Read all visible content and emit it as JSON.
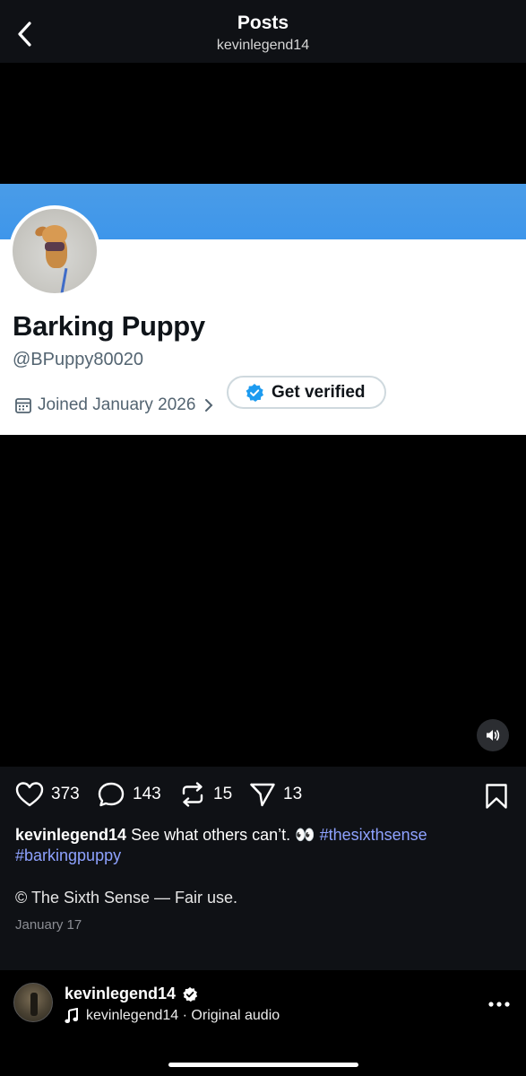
{
  "header": {
    "title": "Posts",
    "subtitle": "kevinlegend14",
    "back_icon": "chevron-left-icon"
  },
  "media": {
    "profile_card": {
      "banner_color": "#4a9ce8",
      "name": "Barking Puppy",
      "verify_label": "Get verified",
      "handle": "@BPuppy80020",
      "joined": "Joined January 2026"
    },
    "sound_icon": "speaker-icon"
  },
  "actions": {
    "likes": "373",
    "comments": "143",
    "reposts": "15",
    "shares": "13"
  },
  "caption": {
    "user": "kevinlegend14",
    "text": "See what others can’t. 👀",
    "tag1": "#thesixthsense",
    "tag2": "#barkingpuppy",
    "copyright": "© The Sixth Sense — Fair use.",
    "date": "January 17"
  },
  "audio": {
    "user": "kevinlegend14",
    "track": "kevinlegend14 · Original audio"
  },
  "colors": {
    "background": "#0f1115",
    "hashtag": "#8ea2ff",
    "verified": "#1d9bf0"
  }
}
